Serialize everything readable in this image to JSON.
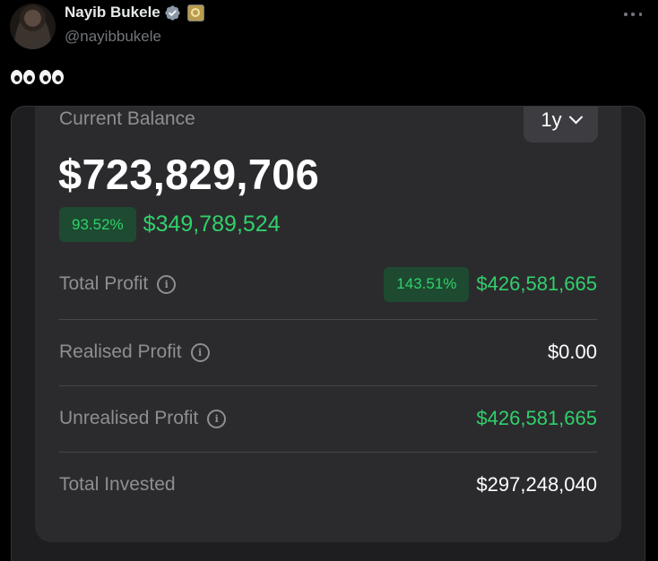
{
  "tweet": {
    "author_name": "Nayib Bukele",
    "handle": "@nayibbukele",
    "text_emoji": [
      "eyes-emoji",
      "eyes-emoji"
    ]
  },
  "wallet": {
    "current_balance_label": "Current Balance",
    "period": "1y",
    "balance": "$723,829,706",
    "change_percent": "93.52%",
    "change_amount": "$349,789,524",
    "rows": [
      {
        "label": "Total Profit",
        "percent": "143.51%",
        "value": "$426,581,665",
        "color": "#31d06b"
      },
      {
        "label": "Realised Profit",
        "value": "$0.00",
        "color": "#ffffff"
      },
      {
        "label": "Unrealised Profit",
        "value": "$426,581,665",
        "color": "#31d06b"
      },
      {
        "label": "Total Invested",
        "value": "$297,248,040",
        "color": "#ffffff"
      }
    ]
  },
  "colors": {
    "background": "#000000",
    "card": "#2b2b2e",
    "positive": "#31d06b",
    "muted": "#8e8e93",
    "verified": "#8b98a5"
  }
}
